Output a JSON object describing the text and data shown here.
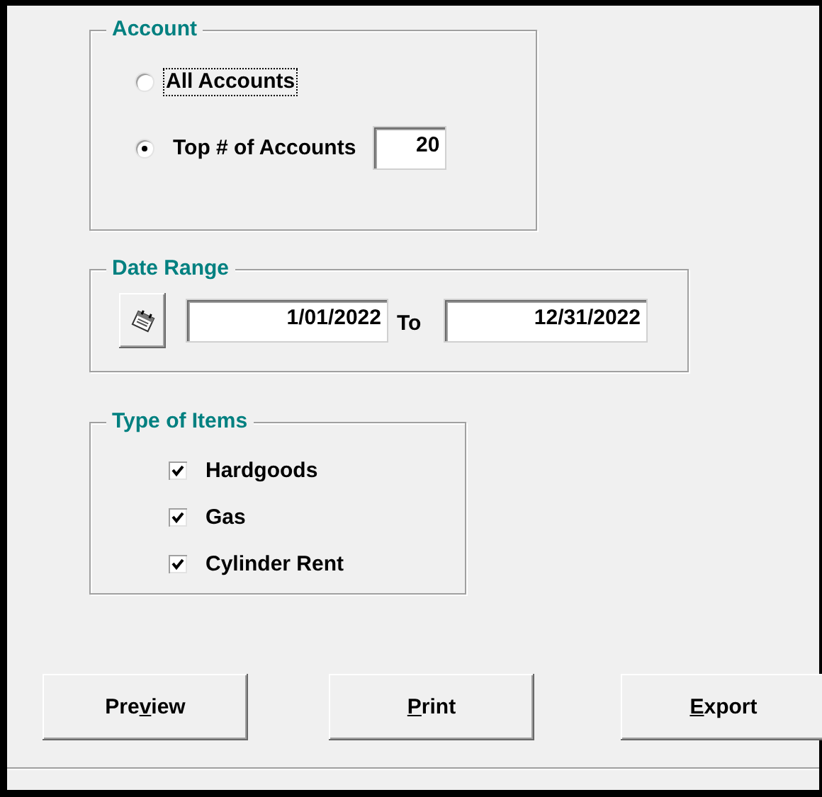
{
  "account": {
    "title": "Account",
    "options": [
      {
        "label": "All Accounts",
        "selected": false,
        "focused": true
      },
      {
        "label": "Top # of Accounts",
        "selected": true,
        "focused": false
      }
    ],
    "top_count": "20"
  },
  "date_range": {
    "title": "Date Range",
    "from": "1/01/2022",
    "separator": "To",
    "to": "12/31/2022"
  },
  "item_types": {
    "title": "Type of Items",
    "items": [
      {
        "label": "Hardgoods",
        "checked": true
      },
      {
        "label": "Gas",
        "checked": true
      },
      {
        "label": "Cylinder Rent",
        "checked": true
      }
    ]
  },
  "buttons": [
    {
      "label_before_key": "Pre",
      "access_key": "v",
      "label_after_key": "iew"
    },
    {
      "access_key": "P",
      "label_after_key": "rint"
    },
    {
      "access_key": "E",
      "label_after_key": "xport"
    }
  ]
}
